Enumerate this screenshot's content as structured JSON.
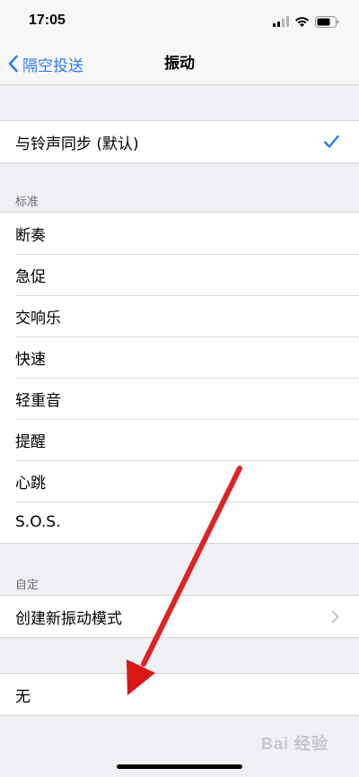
{
  "status_bar": {
    "time": "17:05"
  },
  "nav": {
    "back_label": "隔空投送",
    "title": "振动"
  },
  "sync_row": {
    "label": "与铃声同步 (默认)",
    "selected": true
  },
  "standard": {
    "header": "标准",
    "items": [
      {
        "label": "断奏"
      },
      {
        "label": "急促"
      },
      {
        "label": "交响乐"
      },
      {
        "label": "快速"
      },
      {
        "label": "轻重音"
      },
      {
        "label": "提醒"
      },
      {
        "label": "心跳"
      },
      {
        "label": "S.O.S."
      }
    ]
  },
  "custom": {
    "header": "自定",
    "create_label": "创建新振动模式"
  },
  "none_row": {
    "label": "无"
  },
  "colors": {
    "accent": "#2f7bf5",
    "annotation_arrow": "#e01818"
  },
  "watermark": {
    "text": "Bai 经验"
  }
}
